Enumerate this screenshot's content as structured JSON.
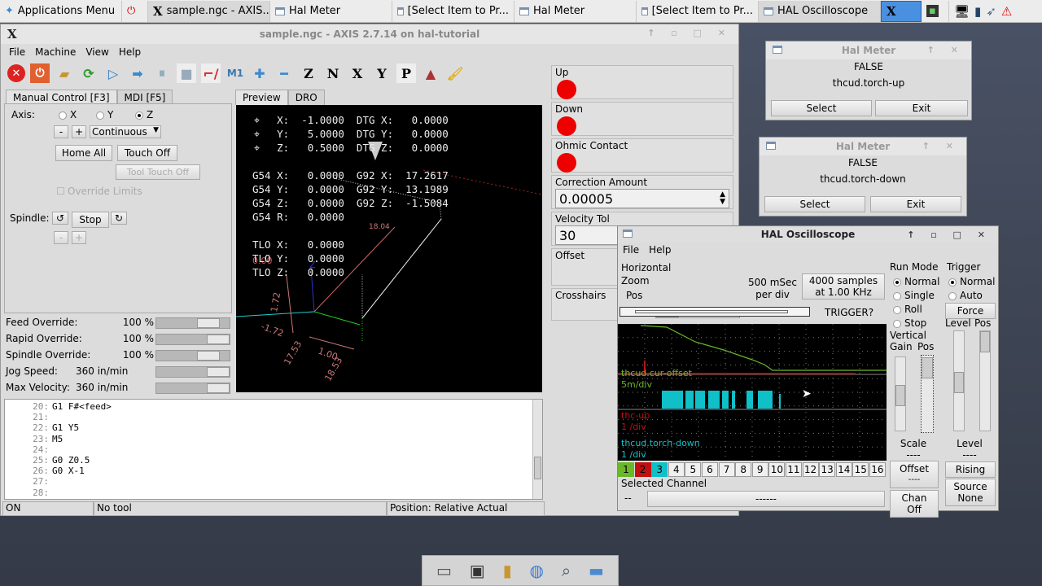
{
  "taskbar": {
    "apps_menu": "Applications Menu",
    "tasks": [
      {
        "label": "sample.ngc - AXIS..."
      },
      {
        "label": "Hal Meter"
      },
      {
        "label": "[Select Item to Pr..."
      },
      {
        "label": "Hal Meter"
      },
      {
        "label": "[Select Item to Pr..."
      },
      {
        "label": "HAL Oscilloscope"
      }
    ]
  },
  "axis": {
    "title": "sample.ngc - AXIS 2.7.14 on hal-tutorial",
    "menu": [
      "File",
      "Machine",
      "View",
      "Help"
    ],
    "tabs": [
      "Manual Control [F3]",
      "MDI [F5]"
    ],
    "axis_label": "Axis:",
    "axes": [
      "X",
      "Y",
      "Z"
    ],
    "selected_axis": "Z",
    "jog_minus": "-",
    "jog_plus": "+",
    "jog_mode": "Continuous",
    "home_all": "Home All",
    "touch_off": "Touch Off",
    "tool_touch_off": "Tool Touch Off",
    "override_limits": "Override Limits",
    "spindle_label": "Spindle:",
    "stop": "Stop",
    "overrides": [
      {
        "label": "Feed Override:",
        "value": "100 %",
        "fraction": 0.8
      },
      {
        "label": "Rapid Override:",
        "value": "100 %",
        "fraction": 1.0
      },
      {
        "label": "Spindle Override:",
        "value": "100 %",
        "fraction": 0.8
      },
      {
        "label": "Jog Speed:",
        "value": "360 in/min",
        "fraction": 1.0
      },
      {
        "label": "Max Velocity:",
        "value": "360 in/min",
        "fraction": 1.0
      }
    ],
    "preview_tabs": [
      "Preview",
      "DRO"
    ],
    "dro": [
      "    X:  -1.0000  DTG X:   0.0000",
      "    Y:   5.0000  DTG Y:   0.0000",
      "    Z:   0.5000  DTG Z:   0.0000",
      "",
      "G54 X:   0.0000  G92 X:  17.2617",
      "G54 Y:   0.0000  G92 Y:  13.1989",
      "G54 Z:   0.0000  G92 Z:  -1.5084",
      "G54 R:   0.0000",
      "",
      "TLO X:   0.0000",
      "TLO Y:   0.0000",
      "TLO Z:   0.0000"
    ],
    "dims": [
      "18.04",
      "1.72",
      "-1.72",
      "17.53",
      "1.00",
      "18.53",
      "0.00"
    ],
    "code": [
      {
        "n": "20:",
        "t": "G1 F#<feed>"
      },
      {
        "n": "21:",
        "t": ""
      },
      {
        "n": "22:",
        "t": "G1 Y5"
      },
      {
        "n": "23:",
        "t": "M5"
      },
      {
        "n": "24:",
        "t": ""
      },
      {
        "n": "25:",
        "t": "G0 Z0.5"
      },
      {
        "n": "26:",
        "t": "G0 X-1"
      },
      {
        "n": "27:",
        "t": ""
      },
      {
        "n": "28:",
        "t": ""
      }
    ],
    "status": {
      "state": "ON",
      "tool": "No tool",
      "position": "Position: Relative Actual"
    }
  },
  "pyvcp": {
    "up": "Up",
    "down": "Down",
    "ohmic": "Ohmic Contact",
    "correction_label": "Correction Amount",
    "correction_value": "0.00005",
    "velocity_label": "Velocity Tol",
    "velocity_value": "30",
    "offset": "Offset",
    "crosshairs": "Crosshairs"
  },
  "meters": [
    {
      "title": "Hal Meter",
      "value": "FALSE",
      "pin": "thcud.torch-up",
      "select": "Select",
      "exit": "Exit"
    },
    {
      "title": "Hal Meter",
      "value": "FALSE",
      "pin": "thcud.torch-down",
      "select": "Select",
      "exit": "Exit"
    }
  ],
  "scope": {
    "title": "HAL Oscilloscope",
    "menu": [
      "File",
      "Help"
    ],
    "horizontal": "Horizontal",
    "zoom": "Zoom",
    "pos": "Pos",
    "rate1": "500 mSec",
    "rate2": "per div",
    "samples1": "4000 samples",
    "samples2": "at 1.00 KHz",
    "trigger_state": "TRIGGER?",
    "run_mode": "Run Mode",
    "modes": [
      "Normal",
      "Single",
      "Roll",
      "Stop"
    ],
    "mode_selected": "Normal",
    "trigger": "Trigger",
    "trig_modes": [
      "Normal",
      "Auto"
    ],
    "force": "Force",
    "level": "Level",
    "tpos": "Pos",
    "vertical": "Vertical",
    "gain": "Gain",
    "vpos": "Pos",
    "scale": "Scale",
    "scale_val": "----",
    "offset": "Offset",
    "offset_val": "----",
    "chan_off": "Chan Off",
    "tlevel": "Level",
    "tlevel_val": "----",
    "rising": "Rising",
    "source1": "Source",
    "source2": "None",
    "traces": [
      {
        "name": "thcud.cur-offset",
        "scale": "5m/div",
        "color": "#6ab82a"
      },
      {
        "name": "thc-up",
        "scale": "1 /div",
        "color": "#c01010"
      },
      {
        "name": "thcud.torch-down",
        "scale": "1 /div",
        "color": "#10c0c8"
      }
    ],
    "channels": [
      "1",
      "2",
      "3",
      "4",
      "5",
      "6",
      "7",
      "8",
      "9",
      "10",
      "11",
      "12",
      "13",
      "14",
      "15",
      "16"
    ],
    "selected_channel": "Selected Channel",
    "sel_num": "--",
    "sel_name": "------"
  }
}
